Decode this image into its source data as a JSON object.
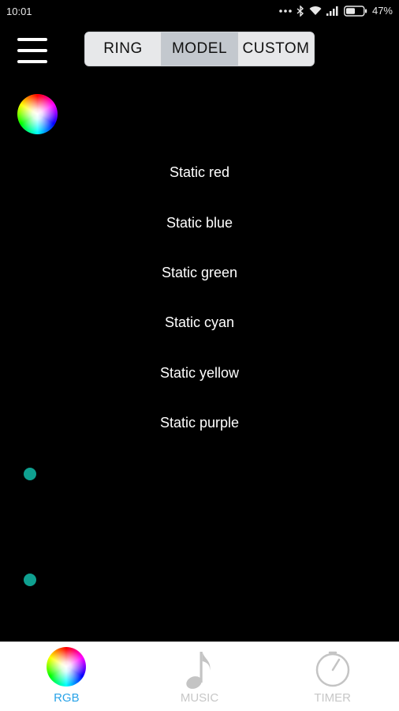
{
  "status_bar": {
    "time": "10:01",
    "battery_percent": "47%",
    "icons": [
      "more-dots-icon",
      "bluetooth-icon",
      "wifi-icon",
      "signal-icon",
      "battery-icon"
    ]
  },
  "header": {
    "menu_icon": "hamburger-menu-icon",
    "tabs": [
      {
        "label": "RING",
        "active": false
      },
      {
        "label": "MODEL",
        "active": true
      },
      {
        "label": "CUSTOM",
        "active": false
      }
    ]
  },
  "color_picker_icon": "color-wheel-icon",
  "modes": [
    {
      "label": "Static red"
    },
    {
      "label": "Static blue"
    },
    {
      "label": "Static green"
    },
    {
      "label": "Static cyan"
    },
    {
      "label": "Static yellow"
    },
    {
      "label": "Static purple"
    }
  ],
  "indicator_color": "#0fa090",
  "bottom_nav": {
    "items": [
      {
        "label": "RGB",
        "icon": "color-wheel-icon",
        "active": true
      },
      {
        "label": "MUSIC",
        "icon": "music-note-icon",
        "active": false
      },
      {
        "label": "TIMER",
        "icon": "timer-icon",
        "active": false
      }
    ],
    "active_color": "#29a3e8",
    "inactive_color": "#c7c7c7"
  }
}
